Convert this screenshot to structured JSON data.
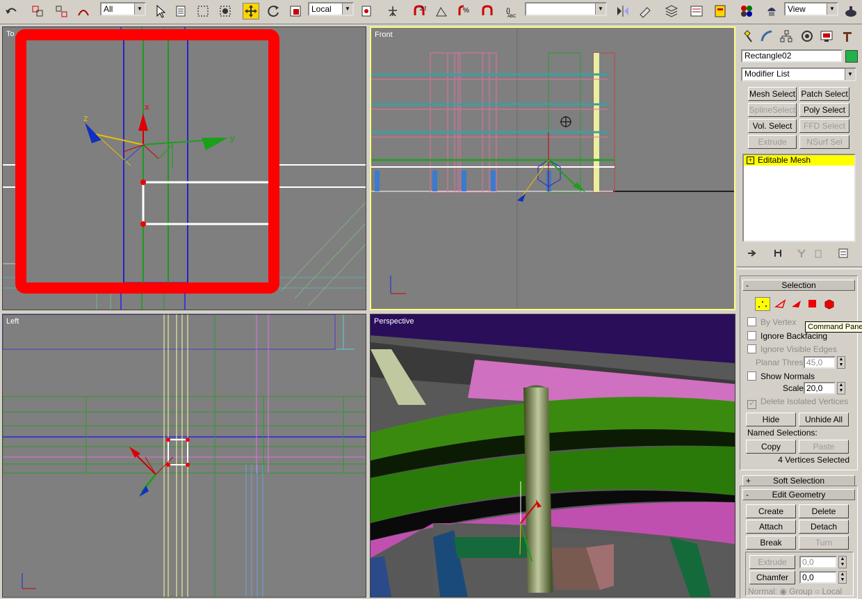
{
  "toolbar": {
    "selection_filter": "All",
    "reference_coord": "Local",
    "named_selection": "",
    "viewport_menu": "View"
  },
  "viewports": {
    "top_label": "To",
    "front_label": "Front",
    "left_label": "Left",
    "perspective_label": "Perspective",
    "gizmo_axes": {
      "x": "x",
      "y": "y",
      "z": "z"
    }
  },
  "panel": {
    "object_name": "Rectangle02",
    "object_color": "#1fb34a",
    "modifier_list": "Modifier List",
    "modifier_buttons": [
      {
        "label": "Mesh Select",
        "enabled": true
      },
      {
        "label": "Patch Select",
        "enabled": true
      },
      {
        "label": "SplineSelect",
        "enabled": false
      },
      {
        "label": "Poly Select",
        "enabled": true
      },
      {
        "label": "Vol. Select",
        "enabled": true
      },
      {
        "label": "FFD Select",
        "enabled": false
      },
      {
        "label": "Extrude",
        "enabled": false
      },
      {
        "label": "NSurf Sel",
        "enabled": false
      }
    ],
    "stack_item": "Editable Mesh",
    "selection": {
      "title": "Selection",
      "by_vertex": "By Vertex",
      "ignore_backfacing": "Ignore Backfacing",
      "ignore_visible_edges": "Ignore Visible Edges",
      "planar_thresh_label": "Planar Thresh:",
      "planar_thresh_value": "45,0",
      "show_normals": "Show Normals",
      "scale_label": "Scale:",
      "scale_value": "20,0",
      "delete_isolated": "Delete Isolated Vertices",
      "hide": "Hide",
      "unhide_all": "Unhide All",
      "named_selections": "Named Selections:",
      "copy": "Copy",
      "paste": "Paste",
      "status": "4 Vertices Selected"
    },
    "soft_selection": "Soft Selection",
    "edit_geometry": {
      "title": "Edit Geometry",
      "create": "Create",
      "delete": "Delete",
      "attach": "Attach",
      "detach": "Detach",
      "break": "Break",
      "turn": "Turn",
      "extrude": "Extrude",
      "extrude_value": "0,0",
      "chamfer": "Chamfer",
      "chamfer_value": "0,0",
      "normal_label": "Normal:",
      "group": "Group",
      "local": "Local"
    }
  },
  "tooltip": "Command Panel",
  "colors": {
    "highlight": "#ff0000",
    "active_viewport": "#ffff80",
    "stack_highlight": "#ffff00"
  }
}
